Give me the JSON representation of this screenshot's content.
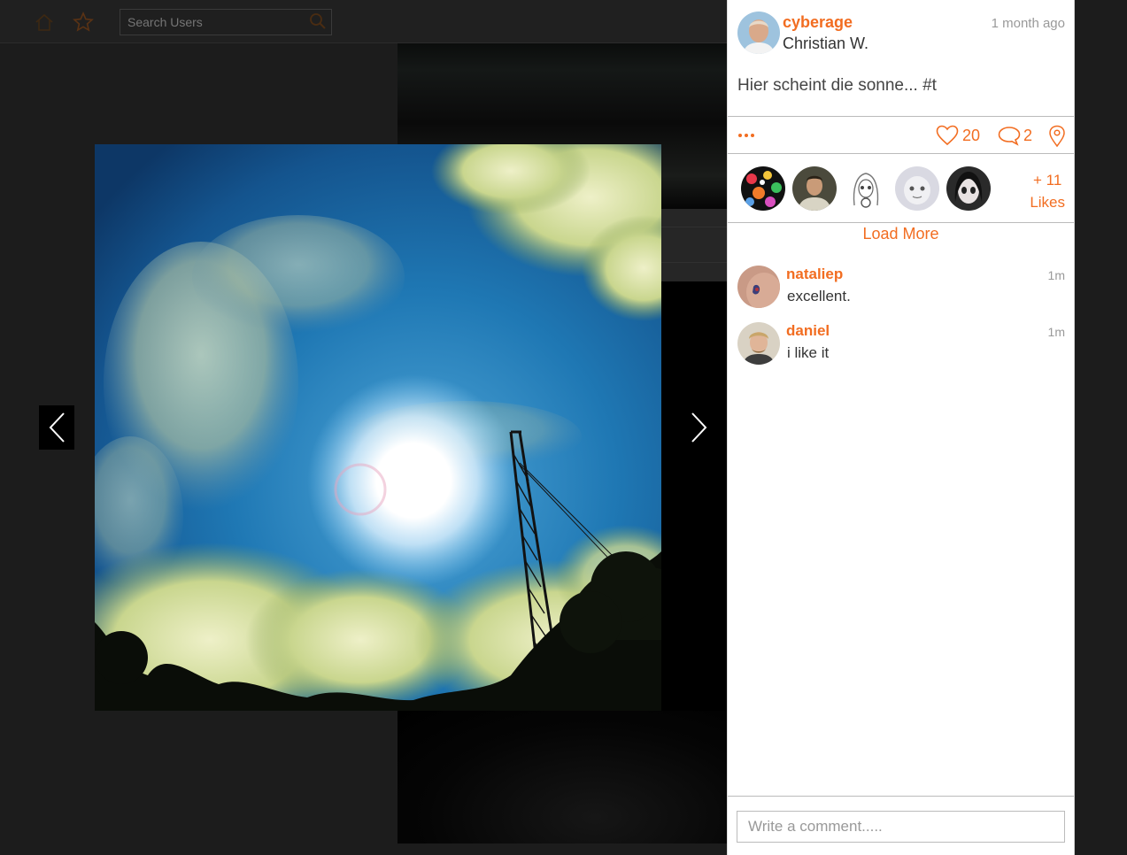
{
  "search": {
    "placeholder": "Search Users"
  },
  "post": {
    "username": "cyberage",
    "full_name": "Christian W.",
    "time": "1 month ago",
    "caption": "Hier scheint die sonne... #t",
    "like_count": "20",
    "comment_count": "2"
  },
  "likes": {
    "more_count": "+ 11",
    "more_label": "Likes"
  },
  "load_more_label": "Load More",
  "comments": [
    {
      "username": "nataliep",
      "text": "excellent.",
      "time": "1m"
    },
    {
      "username": "daniel",
      "text": "i like it",
      "time": "1m"
    }
  ],
  "compose": {
    "placeholder": "Write a comment....."
  },
  "colors": {
    "accent": "#f26d21"
  }
}
